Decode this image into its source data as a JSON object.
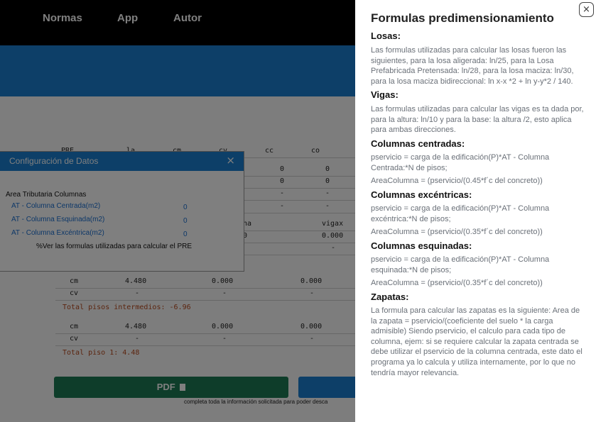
{
  "nav": {
    "items": [
      "Normas",
      "App",
      "Autor"
    ]
  },
  "table": {
    "header": [
      "PRE",
      "la",
      "cm",
      "cv",
      "cc",
      "co"
    ],
    "rows": [
      [
        "",
        "",
        "",
        "",
        "0",
        "0"
      ],
      [
        "",
        "",
        "",
        "",
        "0",
        "0"
      ],
      [
        "",
        "",
        "",
        "",
        "-",
        "-"
      ],
      [
        "",
        "",
        "",
        "",
        "-",
        "-"
      ]
    ],
    "sub_header": [
      "nna",
      "vigax"
    ],
    "sub_row": [
      "00",
      "0.000"
    ],
    "sub_row2": [
      "",
      "-"
    ],
    "group1": {
      "rows": [
        [
          "cm",
          "4.480",
          "0.000",
          "0.000"
        ],
        [
          "cv",
          "-",
          "-",
          "-"
        ]
      ],
      "total": "Total pisos intermedios: -6.96"
    },
    "group2": {
      "rows": [
        [
          "cm",
          "4.480",
          "0.000",
          "0.000"
        ],
        [
          "cv",
          "-",
          "-",
          "-"
        ]
      ],
      "total": "Total piso 1: 4.48"
    }
  },
  "pdf_button": {
    "label": "PDF"
  },
  "footer_note": "completa toda la información solicitada para poder desca",
  "config_modal": {
    "title": "Configuración de Datos",
    "close": "×",
    "section_label": "Area Tributaria Columnas",
    "fields": [
      {
        "label": "AT - Columna Centrada(m2)",
        "value": "0"
      },
      {
        "label": "AT - Columna Esquinada(m2)",
        "value": "0"
      },
      {
        "label": "AT - Columna Excéntrica(m2)",
        "value": "0"
      }
    ],
    "formulas_link": "Ver las formulas utilizadas para calcular el PRE"
  },
  "drawer": {
    "title": "Formulas predimensionamiento",
    "close": "×",
    "losas": {
      "heading": "Losas:",
      "text": "Las formulas utilizadas para calcular las losas fueron las siguientes, para la losa aligerada: ln/25, para la Losa Prefabricada Pretensada: ln/28, para la losa maciza: ln/30, para la losa maciza bidireccional: ln x-x *2 + ln y-y*2 / 140."
    },
    "vigas": {
      "heading": "Vigas:",
      "text": "Las formulas utilizadas para calcular las vigas es ta dada por, para la altura: ln/10 y para la base: la altura /2, esto aplica para ambas direcciones."
    },
    "columnas_centradas": {
      "heading": "Columnas centradas:",
      "line1": "pservicio = carga de la edificación(P)*AT - Columna Centrada:*N de pisos;",
      "line2": "AreaColumna = (pservicio/(0.45*f´c del concreto))"
    },
    "columnas_excentricas": {
      "heading": "Columnas excéntricas:",
      "line1": "pservicio = carga de la edificación(P)*AT - Columna excéntrica:*N de pisos;",
      "line2": "AreaColumna = (pservicio/(0.35*f´c del concreto))"
    },
    "columnas_esquinadas": {
      "heading": "Columnas esquinadas:",
      "line1": "pservicio = carga de la edificación(P)*AT - Columna esquinada:*N de pisos;",
      "line2": "AreaColumna = (pservicio/(0.35*f´c del concreto))"
    },
    "zapatas": {
      "heading": "Zapatas:",
      "text": "La formula para calcular las zapatas es la siguiente: Area de la zapata = pservicio/(coeficiente del suelo * la carga admisible) Siendo pservicio, el calculo para cada tipo de columna, ejem: si se requiere calcular la zapata centrada se debe utilizar el pservicio de la columna centrada, este dato el programa ya lo calcula y utiliza internamente, por lo que no tendría mayor relevancia."
    }
  }
}
